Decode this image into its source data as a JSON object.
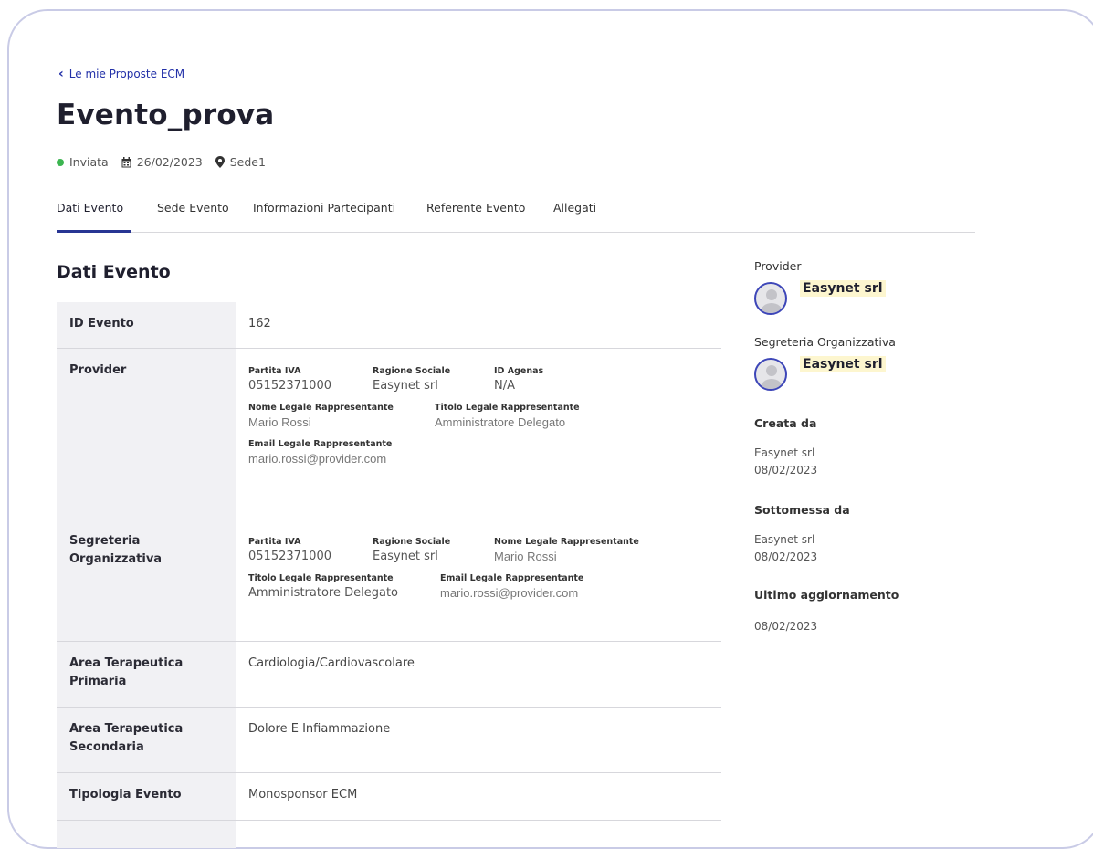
{
  "back": {
    "label": "Le mie Proposte ECM"
  },
  "title": "Evento_prova",
  "meta": {
    "status": "Inviata",
    "date": "26/02/2023",
    "location": "Sede1",
    "status_color": "#3cb550"
  },
  "tabs": [
    "Dati Evento",
    "Sede Evento",
    "Informazioni Partecipanti",
    "Referente Evento",
    "Allegati"
  ],
  "section_title": "Dati Evento",
  "table": {
    "id_evento": {
      "label": "ID Evento",
      "value": "162"
    },
    "provider": {
      "label": "Provider",
      "partita_iva_k": "Partita IVA",
      "partita_iva_v": "05152371000",
      "ragione_k": "Ragione Sociale",
      "ragione_v": "Easynet srl",
      "agenas_k": "ID Agenas",
      "agenas_v": "N/A",
      "nome_k": "Nome Legale Rappresentante",
      "nome_v": "Mario Rossi",
      "titolo_k": "Titolo Legale Rappresentante",
      "titolo_v": "Amministratore Delegato",
      "email_k": "Email Legale Rappresentante",
      "email_v": "mario.rossi@provider.com"
    },
    "segreteria": {
      "label": "Segreteria Organizzativa",
      "partita_iva_k": "Partita IVA",
      "partita_iva_v": "05152371000",
      "ragione_k": "Ragione Sociale",
      "ragione_v": "Easynet srl",
      "nome_k": "Nome Legale Rappresentante",
      "nome_v": "Mario Rossi",
      "titolo_k": "Titolo Legale Rappresentante",
      "titolo_v": "Amministratore Delegato",
      "email_k": "Email Legale Rappresentante",
      "email_v": "mario.rossi@provider.com"
    },
    "area_primaria": {
      "label": "Area Terapeutica Primaria",
      "value": "Cardiologia/Cardiovascolare"
    },
    "area_secondaria": {
      "label": "Area Terapeutica Secondaria",
      "value": "Dolore E Infiammazione"
    },
    "tipologia": {
      "label": "Tipologia Evento",
      "value": "Monosponsor ECM"
    }
  },
  "side": {
    "provider_label": "Provider",
    "provider_name": "Easynet srl",
    "segreteria_label": "Segreteria Organizzativa",
    "segreteria_name": "Easynet srl",
    "creata_label": "Creata da",
    "creata_by": "Easynet srl",
    "creata_date": "08/02/2023",
    "sottomessa_label": "Sottomessa da",
    "sottomessa_by": "Easynet srl",
    "sottomessa_date": "08/02/2023",
    "ultimo_label": "Ultimo aggiornamento",
    "ultimo_date": "08/02/2023"
  }
}
